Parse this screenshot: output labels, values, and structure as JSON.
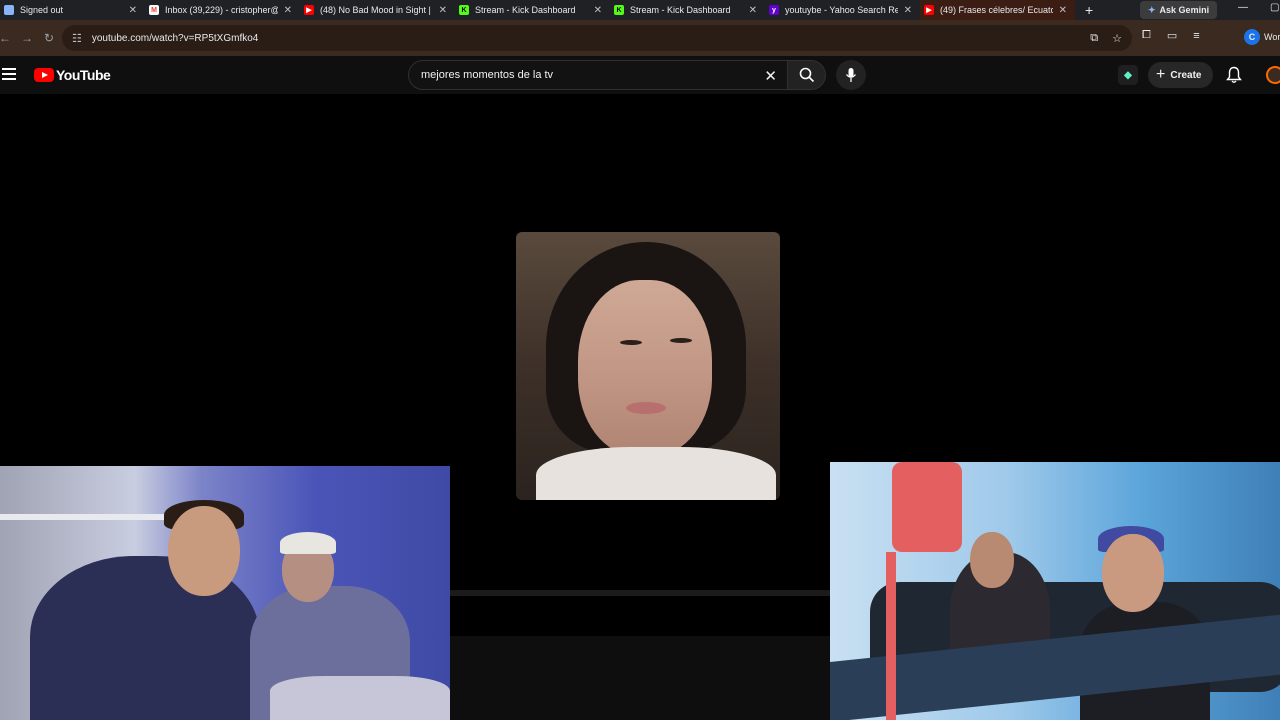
{
  "browser": {
    "tabs": [
      {
        "title": "Signed out",
        "favicon": "browser-page-icon",
        "color": "#8ab4f8",
        "active": false
      },
      {
        "title": "Inbox (39,229) - cristopher@",
        "favicon": "gmail-icon",
        "color": "#ea4335",
        "active": false
      },
      {
        "title": "(48) No Bad Mood in Sight |",
        "favicon": "youtube-icon",
        "color": "#ff0000",
        "active": false
      },
      {
        "title": "Stream - Kick Dashboard",
        "favicon": "kick-icon",
        "color": "#53fc18",
        "active": false
      },
      {
        "title": "Stream - Kick Dashboard",
        "favicon": "kick-icon",
        "color": "#53fc18",
        "active": false
      },
      {
        "title": "youtuybe - Yahoo Search Re",
        "favicon": "yahoo-icon",
        "color": "#6001d2",
        "active": false
      },
      {
        "title": "(49) Frases célebres/ Ecuato",
        "favicon": "youtube-icon",
        "color": "#ff0000",
        "active": true
      }
    ],
    "new_tab": "+",
    "gemini_label": "Ask Gemini",
    "url": "youtube.com/watch?v=RP5tXGmfko4",
    "profile_initial": "C",
    "profile_label": "Wor"
  },
  "youtube": {
    "logo_text": "YouTube",
    "search_query": "mejores momentos de la tv",
    "create_label": "Create",
    "accent": "#ff0000"
  },
  "video": {
    "description": "main video frame"
  }
}
